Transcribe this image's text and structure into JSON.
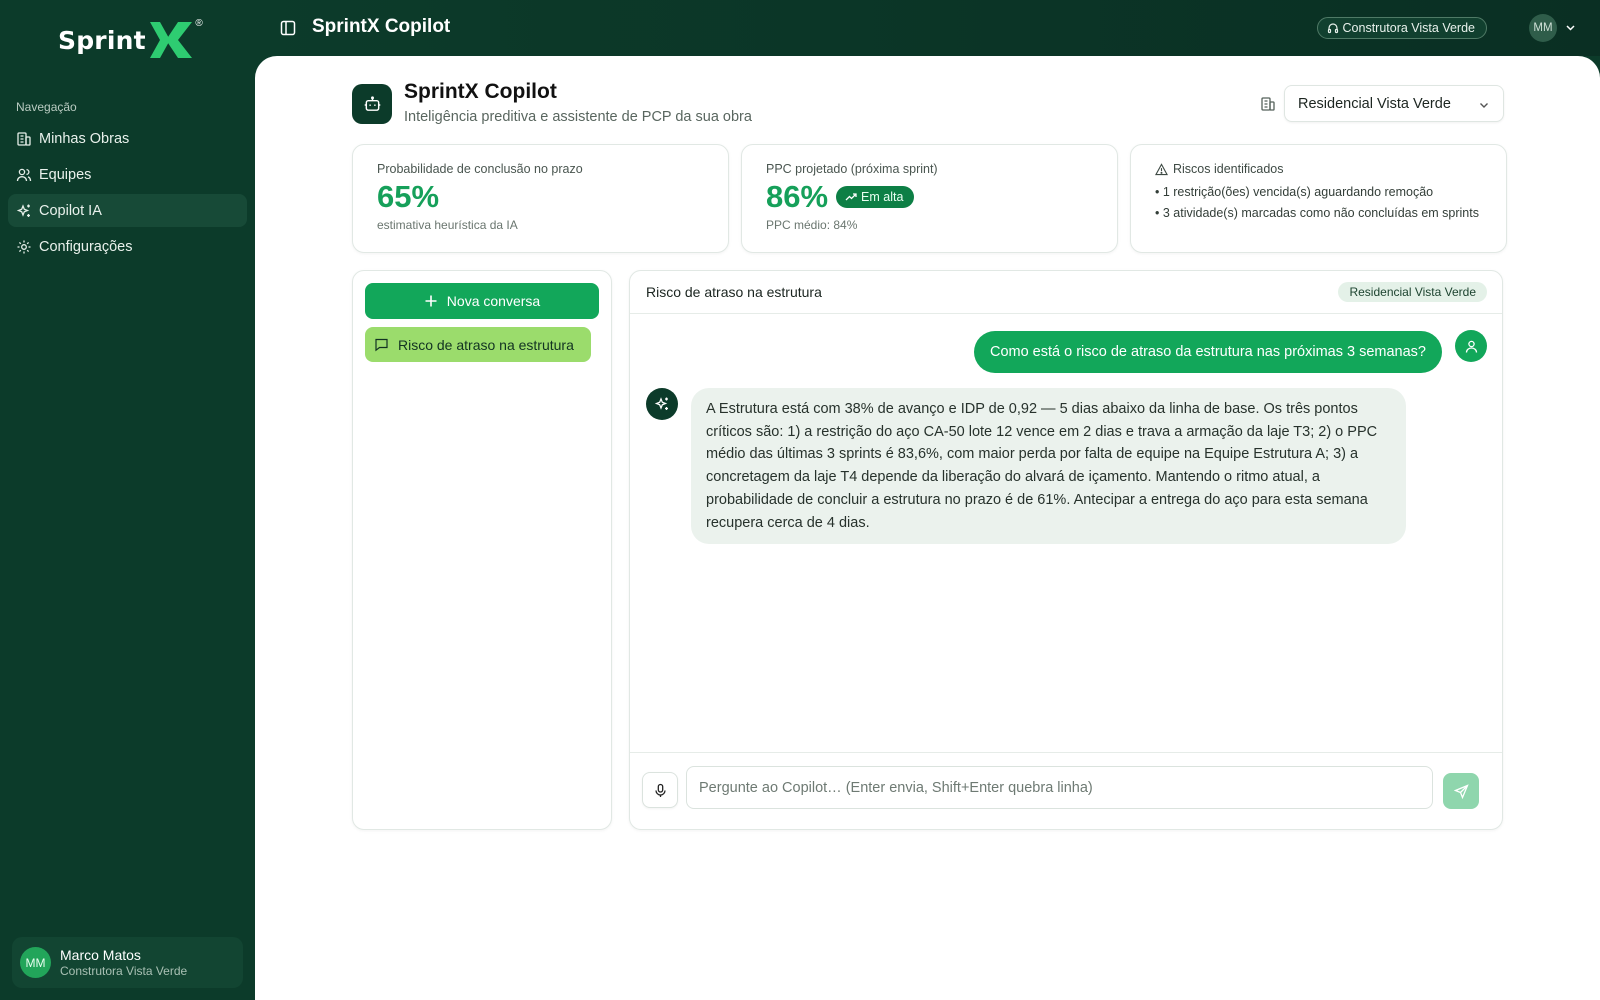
{
  "brand": {
    "name": "Sprint",
    "mark": "X",
    "reg": "®"
  },
  "sidebar": {
    "nav_label": "Navegação",
    "items": [
      {
        "label": "Minhas Obras",
        "icon": "building-icon",
        "active": false
      },
      {
        "label": "Equipes",
        "icon": "users-icon",
        "active": false
      },
      {
        "label": "Copilot IA",
        "icon": "sparkles-icon",
        "active": true
      },
      {
        "label": "Configurações",
        "icon": "gear-icon",
        "active": false
      }
    ],
    "user": {
      "initials": "MM",
      "name": "Marco Matos",
      "company": "Construtora Vista Verde"
    }
  },
  "topbar": {
    "title": "SprintX Copilot",
    "company": "Construtora Vista Verde",
    "avatar_initials": "MM"
  },
  "header": {
    "title": "SprintX Copilot",
    "subtitle": "Inteligência preditiva e assistente de PCP da sua obra",
    "project_selected": "Residencial Vista Verde"
  },
  "stats": {
    "probability": {
      "label": "Probabilidade de conclusão no prazo",
      "value": "65%",
      "sub": "estimativa heurística da IA"
    },
    "ppc": {
      "label": "PPC projetado (próxima sprint)",
      "value": "86%",
      "trend": "Em alta",
      "sub": "PPC médio: 84%"
    },
    "risks": {
      "title": "Riscos identificados",
      "items": [
        "• 1 restrição(ões) vencida(s) aguardando remoção",
        "• 3 atividade(s) marcadas como não concluídas em sprints"
      ]
    }
  },
  "conversations": {
    "new_label": "Nova conversa",
    "items": [
      {
        "title": "Risco de atraso na estrutura",
        "active": true
      }
    ]
  },
  "chat": {
    "title": "Risco de atraso na estrutura",
    "project_badge": "Residencial Vista Verde",
    "messages": [
      {
        "role": "user",
        "text": "Como está o risco de atraso da estrutura nas próximas 3 semanas?"
      },
      {
        "role": "assistant",
        "text": "A Estrutura está com 38% de avanço e IDP de 0,92 — 5 dias abaixo da linha de base. Os três pontos críticos são: 1) a restrição do aço CA-50 lote 12 vence em 2 dias e trava a armação da laje T3; 2) o PPC médio das últimas 3 sprints é 83,6%, com maior perda por falta de equipe na Equipe Estrutura A; 3) a concretagem da laje T4 depende da liberação do alvará de içamento. Mantendo o ritmo atual, a probabilidade de concluir a estrutura no prazo é de 61%. Antecipar a entrega do aço para esta semana recupera cerca de 4 dias."
      }
    ],
    "input_placeholder": "Pergunte ao Copilot… (Enter envia, Shift+Enter quebra linha)",
    "input_value": ""
  },
  "colors": {
    "sidebar_bg": "#0c3b2a",
    "accent_green": "#12a75a",
    "logo_x": "#2ecc71",
    "active_conversation": "#9bdc6c"
  }
}
